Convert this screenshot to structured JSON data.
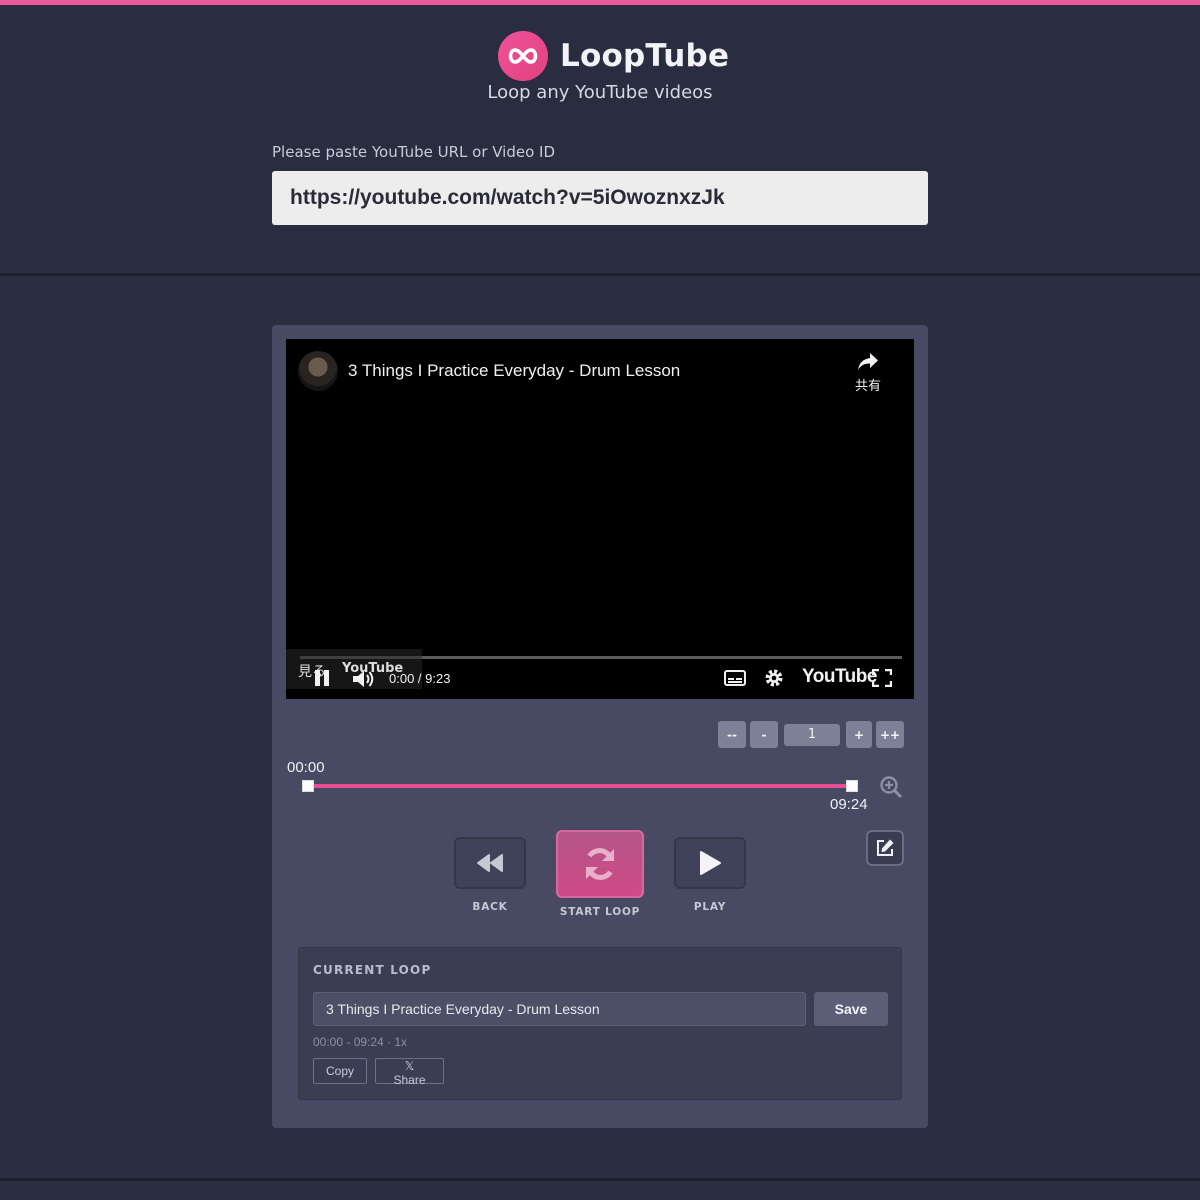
{
  "app": {
    "name": "LoopTube",
    "tagline": "Loop any YouTube videos",
    "logo_icon": "infinity-icon",
    "accent_color": "#e85a9b"
  },
  "url_form": {
    "label": "Please paste YouTube URL or Video ID",
    "value": "https://youtube.com/watch?v=5iOwoznxzJk"
  },
  "player": {
    "video_title": "3 Things I Practice Everyday - Drum Lesson",
    "share_label": "共有",
    "watch_on_label": "見る",
    "small_brand": "YouTube",
    "time_readout": "0:00 / 9:23",
    "brand": "YouTube"
  },
  "speed": {
    "decrease_more": "--",
    "decrease": "-",
    "value": "1",
    "increase": "+",
    "increase_more": "++"
  },
  "range": {
    "start": "00:00",
    "end": "09:24"
  },
  "controls": {
    "back_label": "BACK",
    "loop_label": "START LOOP",
    "play_label": "PLAY"
  },
  "current_loop": {
    "heading": "CURRENT LOOP",
    "name": "3 Things I Practice Everyday - Drum Lesson",
    "save_label": "Save",
    "meta": "00:00 - 09:24 · 1x",
    "copy_label": "Copy",
    "share_label": "𝕏 Share"
  }
}
